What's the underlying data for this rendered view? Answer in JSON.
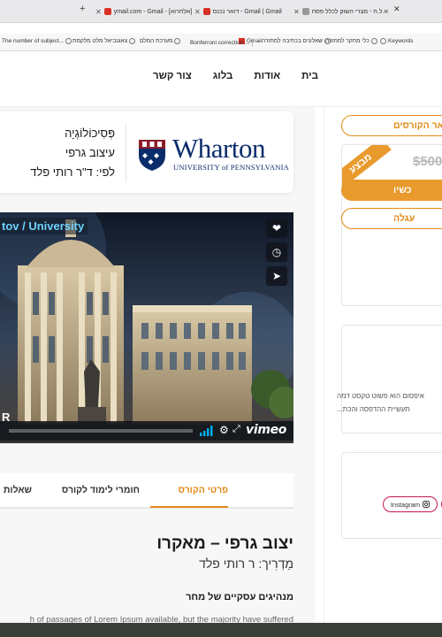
{
  "browser": {
    "tabs": [
      {
        "title": "א.ל.ח - מצרי השוק לכלל פסח",
        "favicon_color": "#888888"
      },
      {
        "title": "דואר נכנס - Gmail | Gmail",
        "favicon_color": "#d93025"
      },
      {
        "title": "ymail.com - Gmail - [אלחרוא]",
        "favicon_color": "#d93025"
      }
    ],
    "bookmarks": [
      "Keywords",
      "כלי מחקר למחזרה",
      "שאלונים בכתיבה למחזרה",
      "Gmail",
      "Bonferroni correction ...",
      "מערכת המלם",
      "צאגנביאל מלט מלקמת",
      "The number of subject..."
    ]
  },
  "nav": {
    "home": "בית",
    "about": "אודות",
    "blog": "בלוג",
    "contact": "צור קשר"
  },
  "header": {
    "logo_word": "Wharton",
    "logo_sub": "UNIVERSITY of PENNSYLVANIA",
    "line1": "פְּסִיכוֹלוֹגְיָה",
    "line2": "עיצוב גרפי",
    "line3": "לפי: ד\"ר רותי פלד"
  },
  "video": {
    "title": "tov / University",
    "corner_letter": "R",
    "brand": "vimeo",
    "progress": 0.0,
    "icons": [
      "heart-icon",
      "clock-icon",
      "send-icon",
      "gear-icon",
      "fullscreen-icon"
    ]
  },
  "course_tabs": {
    "details": "פרטי הקורס",
    "materials": "חומרי לימוד לקורס",
    "questions": "שאלות"
  },
  "course": {
    "title": "יצוב גרפי – מאקרו",
    "instructor": "מַדְרִיך: ר רותי פלד",
    "subtitle": "מנהיגים עסקיים של מחר",
    "body": "h of passages of Lorem Ipsum available, but the majority have suffered"
  },
  "sidebar": {
    "courses_button": "אר הקורסים",
    "badge": "מבצע",
    "old_price": "$500",
    "buy_button": "כשיו",
    "cart_button": "עגלה",
    "card2_text_1": "איפסום הוא פשוט טקסט דמה",
    "card2_text_2": "תעשיית ההדפסה והכת...",
    "instagram_label": "Instagram"
  },
  "colors": {
    "accent": "#e38a17",
    "wharton_blue": "#0b2c6a",
    "video_title": "#6fd0ff",
    "instagram_border": "#c2185b"
  }
}
